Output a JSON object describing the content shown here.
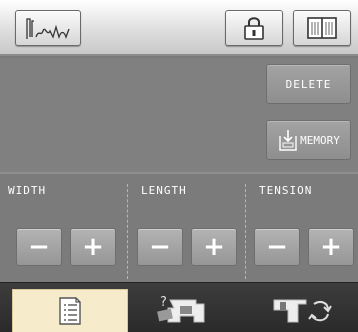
{
  "top_bar": {
    "stitch_icon": "stitch-pattern-icon",
    "lock_icon": "padlock-icon",
    "book_icon": "open-book-icon"
  },
  "work_area": {
    "delete_label": "DELETE",
    "memory_label": "MEMORY"
  },
  "controls": [
    {
      "label": "WIDTH",
      "minus": "−",
      "plus": "+"
    },
    {
      "label": "LENGTH",
      "minus": "−",
      "plus": "+"
    },
    {
      "label": "TENSION",
      "minus": "−",
      "plus": "+"
    }
  ],
  "tabs": [
    {
      "icon": "stitch-list-icon",
      "selected": true
    },
    {
      "icon": "help-machine-icon",
      "selected": false
    },
    {
      "icon": "machine-settings-icon",
      "selected": false
    }
  ],
  "colors": {
    "panel_gray": "#808080",
    "tab_selected": "#f6eccb",
    "tab_bar": "#333333"
  }
}
